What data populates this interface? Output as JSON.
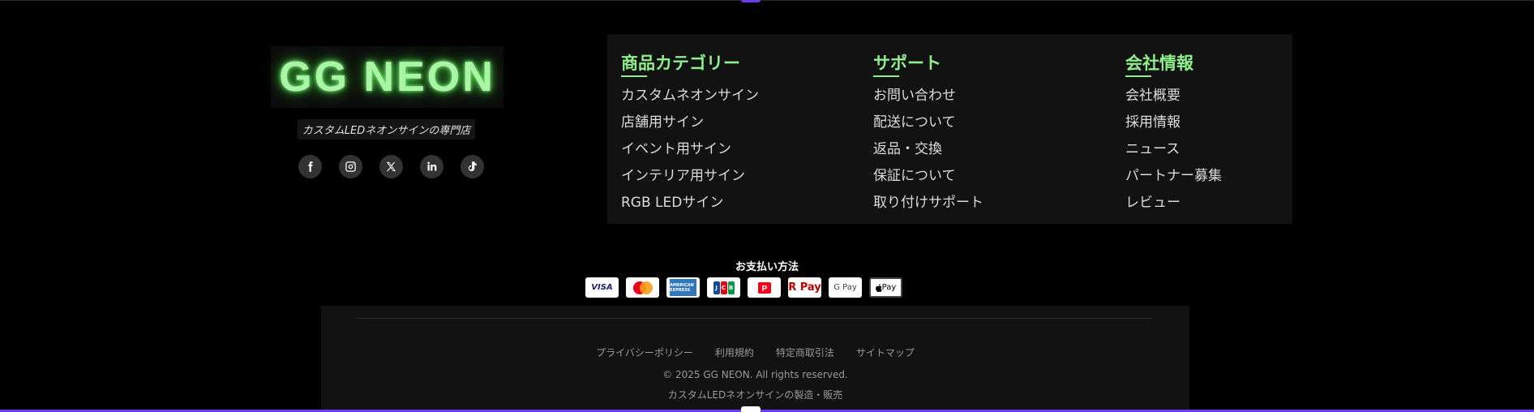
{
  "brand": {
    "logo_text": "GG NEON",
    "tagline": "カスタムLEDネオンサインの専門店",
    "accent_color": "#8ef08b"
  },
  "socials": [
    {
      "name": "facebook-icon"
    },
    {
      "name": "instagram-icon"
    },
    {
      "name": "x-twitter-icon"
    },
    {
      "name": "linkedin-icon"
    },
    {
      "name": "tiktok-icon"
    }
  ],
  "columns": [
    {
      "title": "商品カテゴリー",
      "items": [
        "カスタムネオンサイン",
        "店舗用サイン",
        "イベント用サイン",
        "インテリア用サイン",
        "RGB LEDサイン"
      ]
    },
    {
      "title": "サポート",
      "items": [
        "お問い合わせ",
        "配送について",
        "返品・交換",
        "保証について",
        "取り付けサポート"
      ]
    },
    {
      "title": "会社情報",
      "items": [
        "会社概要",
        "採用情報",
        "ニュース",
        "パートナー募集",
        "レビュー"
      ]
    }
  ],
  "payment": {
    "title": "お支払い方法",
    "methods": [
      {
        "name": "visa-icon",
        "label": "VISA"
      },
      {
        "name": "mastercard-icon",
        "label": ""
      },
      {
        "name": "amex-icon",
        "label": "AMERICAN EXPRESS"
      },
      {
        "name": "jcb-icon",
        "label": "JCB"
      },
      {
        "name": "paypay-icon",
        "label": ""
      },
      {
        "name": "rakuten-pay-icon",
        "label": "R Pay"
      },
      {
        "name": "google-pay-icon",
        "label": "G Pay"
      },
      {
        "name": "apple-pay-icon",
        "label": "Pay"
      }
    ]
  },
  "footer": {
    "links": [
      "プライバシーポリシー",
      "利用規約",
      "特定商取引法",
      "サイトマップ"
    ],
    "copyright": "© 2025 GG NEON. All rights reserved.",
    "subtext": "カスタムLEDネオンサインの製造・販売"
  }
}
